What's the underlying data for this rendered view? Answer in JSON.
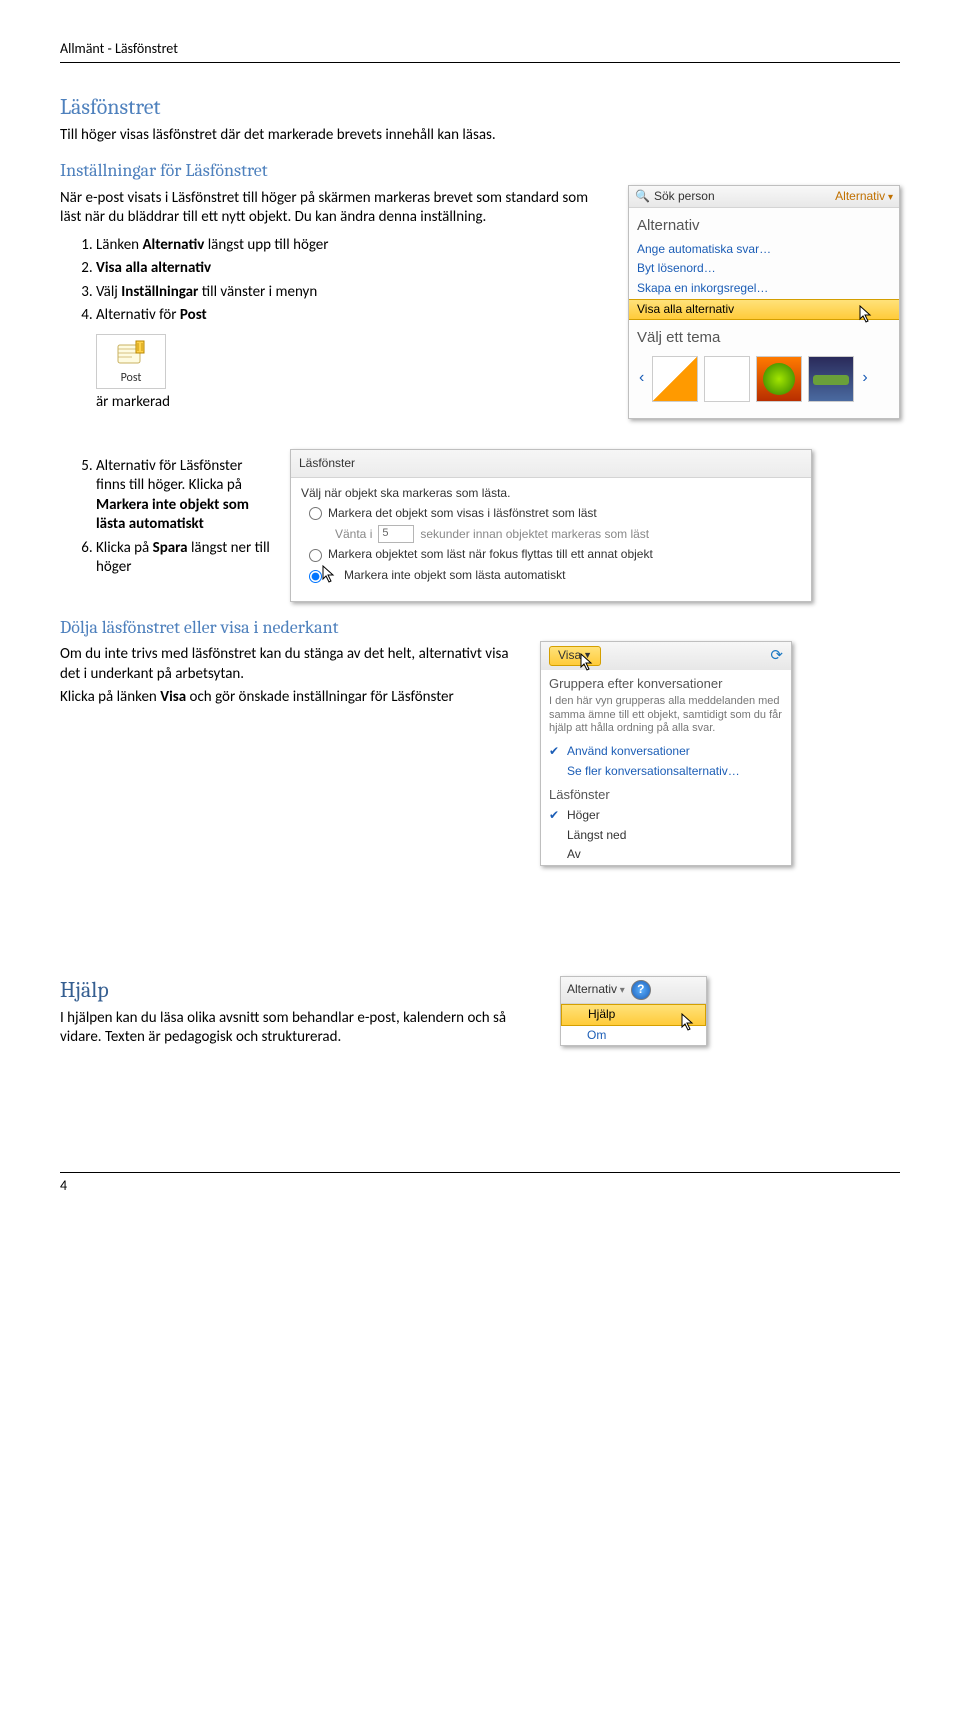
{
  "header": {
    "text": "Allmänt - Läsfönstret"
  },
  "s1": {
    "title": "Läsfönstret",
    "intro": "Till höger visas läsfönstret där det markerade brevets innehåll kan läsas."
  },
  "s2": {
    "title": "Inställningar för Läsfönstret",
    "intro": "När e-post visats i Läsfönstret till höger på skärmen markeras brevet som standard som läst när du bläddrar till ett nytt objekt. Du kan ändra denna inställning.",
    "li1a": "Länken ",
    "li1b": "Alternativ",
    "li1c": " längst upp till höger",
    "li2": "Visa alla alternativ",
    "li3a": "Välj ",
    "li3b": "Inställningar",
    "li3c": " till vänster i menyn",
    "li4a": "Alternativ för ",
    "li4b": "Post",
    "marked": "är markerad",
    "li5a": "Alternativ för Läsfönster finns till höger. Klicka på ",
    "li5b": "Markera inte objekt som lästa automatiskt",
    "li6a": "Klicka på ",
    "li6b": "Spara",
    "li6c": " längst ner till höger"
  },
  "s3": {
    "title": "Dölja läsfönstret eller visa i nederkant",
    "p1": "Om du inte trivs med läsfönstret kan du stänga av det helt, alternativt visa det i underkant på arbetsytan.",
    "p2a": "Klicka på länken ",
    "p2b": "Visa",
    "p2c": " och gör önskade inställningar för Läsfönster"
  },
  "help": {
    "title": "Hjälp",
    "p": "I hjälpen kan du läsa olika avsnitt som behandlar e-post, kalendern och så vidare. Texten är pedagogisk och strukturerad."
  },
  "shot1": {
    "sok": "Sök person",
    "alt": "Alternativ",
    "panel_title": "Alternativ",
    "l1": "Ange automatiska svar…",
    "l2": "Byt lösenord…",
    "l3": "Skapa en inkorgsregel…",
    "hl": "Visa alla alternativ",
    "theme_title": "Välj ett tema"
  },
  "post_icon": {
    "label": "Post"
  },
  "shot2": {
    "hd": "Läsfönster",
    "desc": "Välj när objekt ska markeras som lästa.",
    "o1": "Markera det objekt som visas i läsfönstret som läst",
    "o2a": "Vänta i",
    "o2val": "5",
    "o2b": "sekunder innan objektet markeras som läst",
    "o3": "Markera objektet som läst när fokus flyttas till ett annat objekt",
    "o4": "Markera inte objekt som lästa automatiskt"
  },
  "shot3": {
    "visa": "Visa",
    "grp_title": "Gruppera efter konversationer",
    "grp_desc": "I den här vyn grupperas alla meddelanden med samma ämne till ett objekt, samtidigt som du får hjälp att hålla ordning på alla svar.",
    "m1": "Använd konversationer",
    "m2": "Se fler konversationsalternativ…",
    "sec": "Läsfönster",
    "m3": "Höger",
    "m4": "Längst ned",
    "m5": "Av"
  },
  "shot4": {
    "alt": "Alternativ",
    "hjalp": "Hjälp",
    "om": "Om"
  },
  "footer": {
    "page": "4"
  }
}
